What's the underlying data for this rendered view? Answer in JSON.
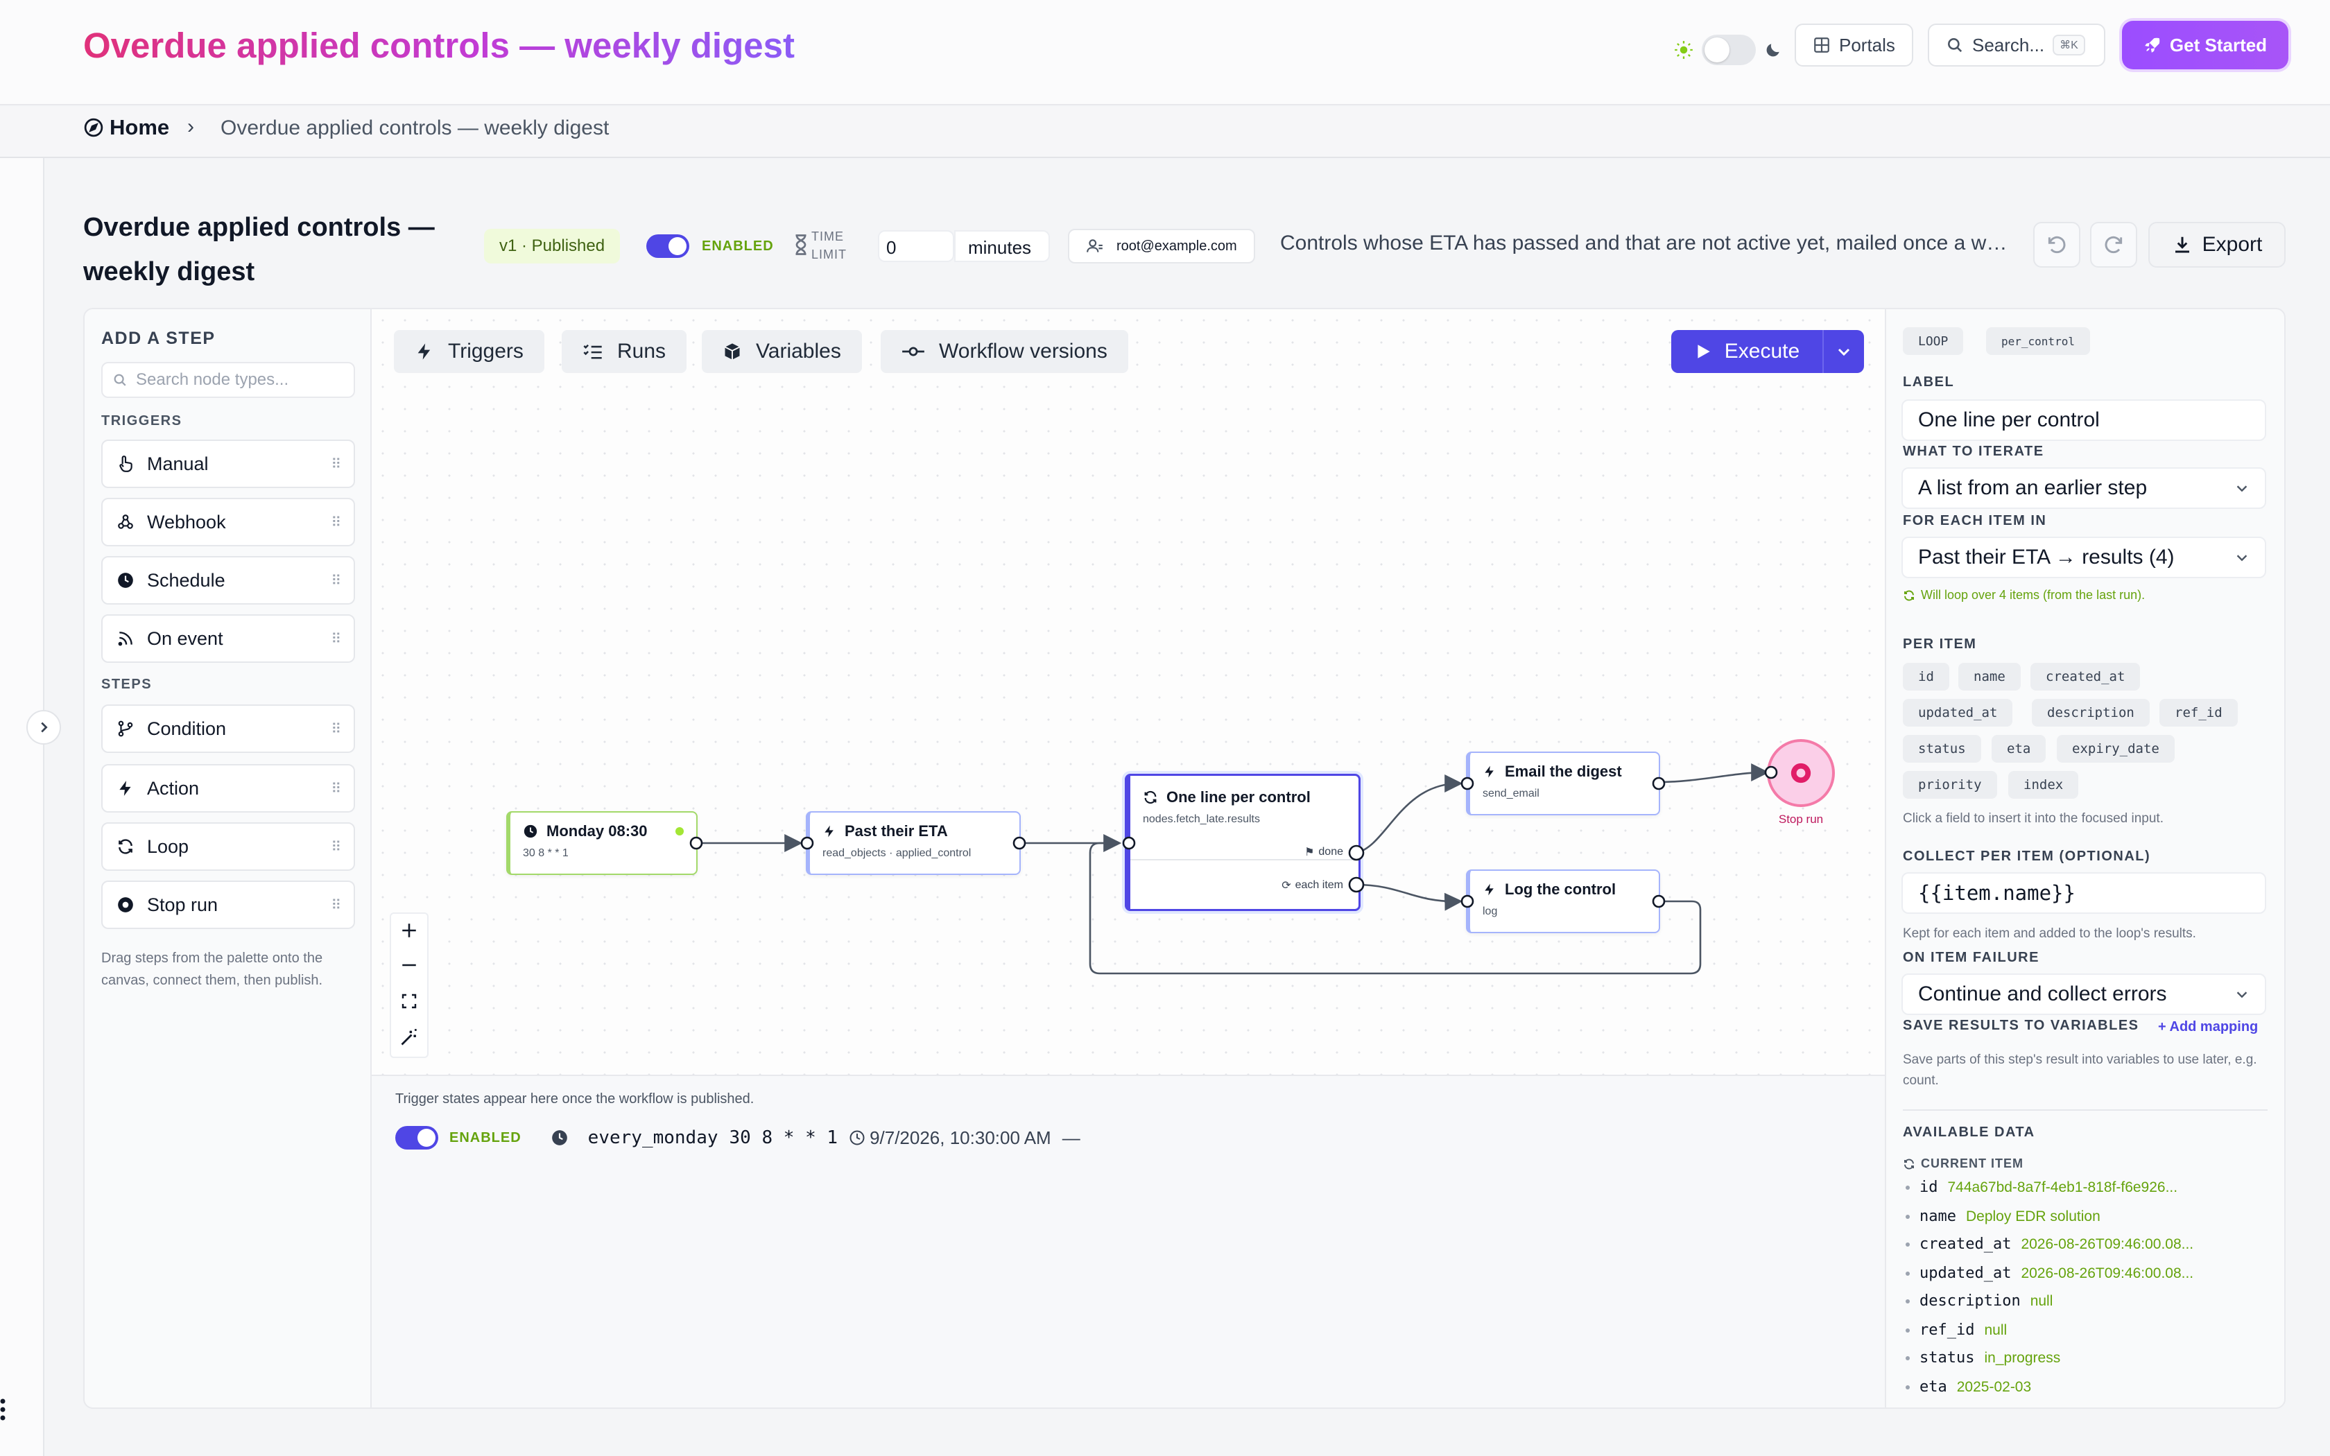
{
  "header": {
    "title": "Overdue applied controls — weekly digest",
    "portals_label": "Portals",
    "search_placeholder": "Search...",
    "search_shortcut": "⌘K",
    "get_started_label": "Get Started"
  },
  "breadcrumb": {
    "home": "Home",
    "separator": "›",
    "current": "Overdue applied controls — weekly digest"
  },
  "workflow": {
    "title": "Overdue applied controls — weekly digest",
    "version": "v1 · Published",
    "enabled_label": "ENABLED",
    "time_limit_label_1": "TIME",
    "time_limit_label_2": "LIMIT",
    "time_limit_value": "0",
    "time_limit_unit": "minutes",
    "owner": "root@example.com",
    "description": "Controls whose ETA has passed and that are not active yet, mailed once a week.",
    "export_label": "Export"
  },
  "palette": {
    "title": "ADD A STEP",
    "search_placeholder": "Search node types...",
    "triggers_heading": "TRIGGERS",
    "triggers": [
      "Manual",
      "Webhook",
      "Schedule",
      "On event"
    ],
    "steps_heading": "STEPS",
    "steps": [
      "Condition",
      "Action",
      "Loop",
      "Stop run"
    ],
    "hint": "Drag steps from the palette onto the canvas, connect them, then publish."
  },
  "toolbar": {
    "triggers": "Triggers",
    "runs": "Runs",
    "variables": "Variables",
    "versions": "Workflow versions",
    "execute": "Execute"
  },
  "nodes": {
    "trigger": {
      "title": "Monday 08:30",
      "sub": "30 8 * * 1"
    },
    "fetch": {
      "title": "Past their ETA",
      "sub": "read_objects · applied_control"
    },
    "loop": {
      "title": "One line per control",
      "sub": "nodes.fetch_late.results",
      "done": "done",
      "each": "each item"
    },
    "email": {
      "title": "Email the digest",
      "sub": "send_email"
    },
    "log": {
      "title": "Log the control",
      "sub": "log"
    },
    "stop": {
      "title": "Stop run"
    }
  },
  "trigger_panel": {
    "note": "Trigger states appear here once the workflow is published.",
    "enabled_label": "ENABLED",
    "name": "every_monday",
    "cron": "30 8 * * 1",
    "next_run": "9/7/2026, 10:30:00 AM",
    "dash": "—"
  },
  "inspector": {
    "type_tag": "LOOP",
    "id_tag": "per_control",
    "label_heading": "LABEL",
    "label_value": "One line per control",
    "iterate_heading": "WHAT TO ITERATE",
    "iterate_value": "A list from an earlier step",
    "foreach_heading": "FOR EACH ITEM IN",
    "foreach_value": "Past their ETA → results (4)",
    "loop_note": "Will loop over 4 items (from the last run).",
    "per_item_heading": "PER ITEM",
    "fields": [
      "id",
      "name",
      "created_at",
      "updated_at",
      "description",
      "ref_id",
      "status",
      "eta",
      "expiry_date",
      "priority",
      "index"
    ],
    "fields_note": "Click a field to insert it into the focused input.",
    "collect_heading": "COLLECT PER ITEM (OPTIONAL)",
    "collect_value": "{{item.name}}",
    "collect_note": "Kept for each item and added to the loop's results.",
    "failure_heading": "ON ITEM FAILURE",
    "failure_value": "Continue and collect errors",
    "save_heading": "SAVE RESULTS TO VARIABLES",
    "add_mapping": "+ Add mapping",
    "save_note": "Save parts of this step's result into variables to use later, e.g. count.",
    "available_heading": "AVAILABLE DATA",
    "current_item_heading": "CURRENT ITEM",
    "current_item": [
      {
        "k": "id",
        "v": "744a67bd-8a7f-4eb1-818f-f6e926..."
      },
      {
        "k": "name",
        "v": "Deploy EDR solution"
      },
      {
        "k": "created_at",
        "v": "2026-08-26T09:46:00.08..."
      },
      {
        "k": "updated_at",
        "v": "2026-08-26T09:46:00.08..."
      },
      {
        "k": "description",
        "v": "null"
      },
      {
        "k": "ref_id",
        "v": "null"
      },
      {
        "k": "status",
        "v": "in_progress"
      },
      {
        "k": "eta",
        "v": "2025-02-03"
      }
    ]
  },
  "colors": {
    "accent": "#4f46e5",
    "success": "#65a30d",
    "brand_gradient_start": "#e0317a",
    "brand_gradient_end": "#8b5cf6"
  }
}
